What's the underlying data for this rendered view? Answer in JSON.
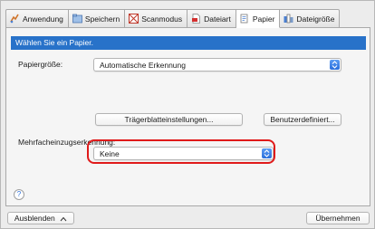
{
  "tabs": [
    {
      "label": "Anwendung",
      "icon": "application-icon"
    },
    {
      "label": "Speichern",
      "icon": "save-icon"
    },
    {
      "label": "Scanmodus",
      "icon": "scan-mode-icon"
    },
    {
      "label": "Dateiart",
      "icon": "file-type-icon"
    },
    {
      "label": "Papier",
      "icon": "paper-icon"
    },
    {
      "label": "Dateigröße",
      "icon": "file-size-icon"
    }
  ],
  "active_tab": "Papier",
  "header": {
    "title": "Wählen Sie ein Papier."
  },
  "paper_size": {
    "label": "Papiergröße:",
    "value": "Automatische Erkennung"
  },
  "buttons": {
    "carrier_sheet": "Trägerblatteinstellungen...",
    "custom": "Benutzerdefiniert..."
  },
  "multifeed": {
    "label": "Mehrfacheinzugserkennung:",
    "value": "Keine"
  },
  "help": {
    "symbol": "?"
  },
  "footer": {
    "hide_label": "Ausblenden",
    "apply_label": "Übernehmen"
  },
  "colors": {
    "header_bg": "#2872c9",
    "highlight": "#e01a1a",
    "stepper": "#2a6fdc"
  }
}
